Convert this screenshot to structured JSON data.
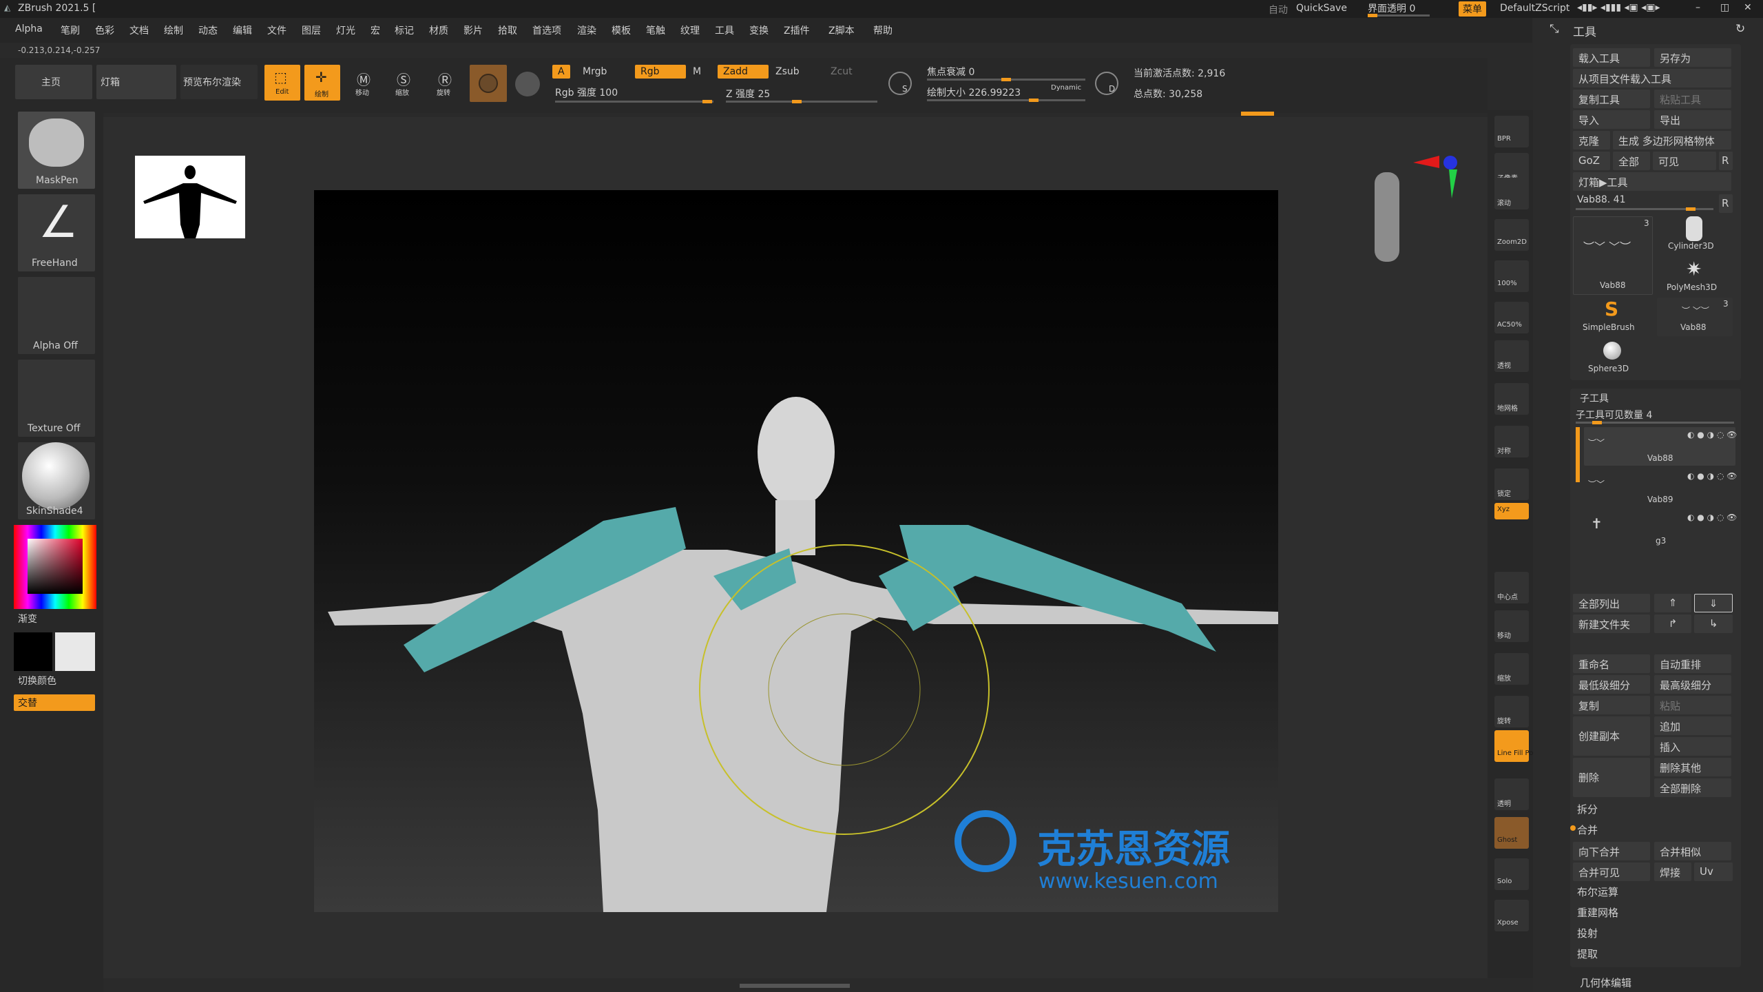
{
  "app": {
    "title": "ZBrush 2021.5 [",
    "coords": "-0.213,0.214,-0.257"
  },
  "topright": {
    "auto": "自动",
    "quicksave": "QuickSave",
    "transparency": "界面透明 0",
    "menu": "菜单",
    "script": "DefaultZScript"
  },
  "menu": [
    "Alpha",
    "笔刷",
    "色彩",
    "文档",
    "绘制",
    "动态",
    "编辑",
    "文件",
    "图层",
    "灯光",
    "宏",
    "标记",
    "材质",
    "影片",
    "拾取",
    "首选项",
    "渲染",
    "模板",
    "笔触",
    "纹理",
    "工具",
    "变换",
    "Z插件",
    "Z脚本",
    "帮助"
  ],
  "shelf": {
    "home": "主页",
    "lightbox": "灯箱",
    "bpr": "预览布尔渲染",
    "edit": "Edit",
    "draw": "绘制",
    "move": "移动",
    "scale": "缩放",
    "rotate": "旋转",
    "a": "A",
    "mrgb": "Mrgb",
    "rgb": "Rgb",
    "m": "M",
    "rgb_intensity": "Rgb 强度 100",
    "zadd": "Zadd",
    "zsub": "Zsub",
    "zcut": "Zcut",
    "z_intensity": "Z 强度 25",
    "focal": "焦点衰减 0",
    "draw_size": "绘制大小 226.99223",
    "dynamic": "Dynamic",
    "active_points": "当前激活点数: 2,916",
    "total_points": "总点数: 30,258",
    "s": "S",
    "d": "D"
  },
  "leftpanel": {
    "maskpen": "MaskPen",
    "freehand": "FreeHand",
    "alpha": "Alpha Off",
    "texture": "Texture Off",
    "material": "SkinShade4",
    "gradient": "渐变",
    "switch": "切换颜色",
    "alternate": "交替"
  },
  "righticons": [
    "BPR",
    "子像素",
    "滚动",
    "Zoom2D",
    "100%",
    "AC50%",
    "透视",
    "地网格",
    "对称",
    "锁定",
    "Xyz",
    "中心点",
    "移动",
    "缩放",
    "旋转",
    "Line Fill PolyF",
    "透明",
    "Ghost",
    "Solo",
    "Xpose"
  ],
  "tool": {
    "header": "工具",
    "load": "载入工具",
    "saveas": "另存为",
    "load_project": "从项目文件载入工具",
    "copy": "复制工具",
    "paste": "粘贴工具",
    "import": "导入",
    "export": "导出",
    "clone": "克隆",
    "make_polymesh": "生成 多边形网格物体",
    "goz": "GoZ",
    "all": "全部",
    "visible": "可见",
    "r": "R",
    "lightbox_tool": "灯箱▶工具",
    "current": "Vab88. 41",
    "items": [
      {
        "name": "Vab88",
        "count": "3"
      },
      {
        "name": "Cylinder3D"
      },
      {
        "name": "PolyMesh3D"
      },
      {
        "name": "SimpleBrush"
      },
      {
        "name": "Vab88",
        "count": "3"
      },
      {
        "name": "Sphere3D"
      }
    ]
  },
  "subtool": {
    "header": "子工具",
    "visible_count": "子工具可见数量 4",
    "items": [
      "Vab88",
      "Vab89",
      "g3"
    ],
    "list_all": "全部列出",
    "new_folder": "新建文件夹",
    "rename": "重命名",
    "autoreorder": "自动重排",
    "lowest": "最低级细分",
    "highest": "最高级细分",
    "duplicate": "复制",
    "paste": "粘贴",
    "create_copy": "创建副本",
    "append": "追加",
    "insert": "插入",
    "delete": "删除",
    "delete_other": "删除其他",
    "delete_all": "全部删除",
    "split": "拆分",
    "merge": "合并",
    "merge_down": "向下合并",
    "merge_similar": "合并相似",
    "merge_visible": "合并可见",
    "weld": "焊接",
    "uv": "Uv",
    "boolean": "布尔运算",
    "remesh": "重建网格",
    "project": "投射",
    "extract": "提取",
    "geometry": "几何体编辑"
  },
  "watermark": {
    "text": "克苏恩资源",
    "url": "www.kesuen.com"
  },
  "colors": {
    "accent": "#f39a1c",
    "bg": "#2a2a2a",
    "watermark": "#1f7fd6"
  }
}
